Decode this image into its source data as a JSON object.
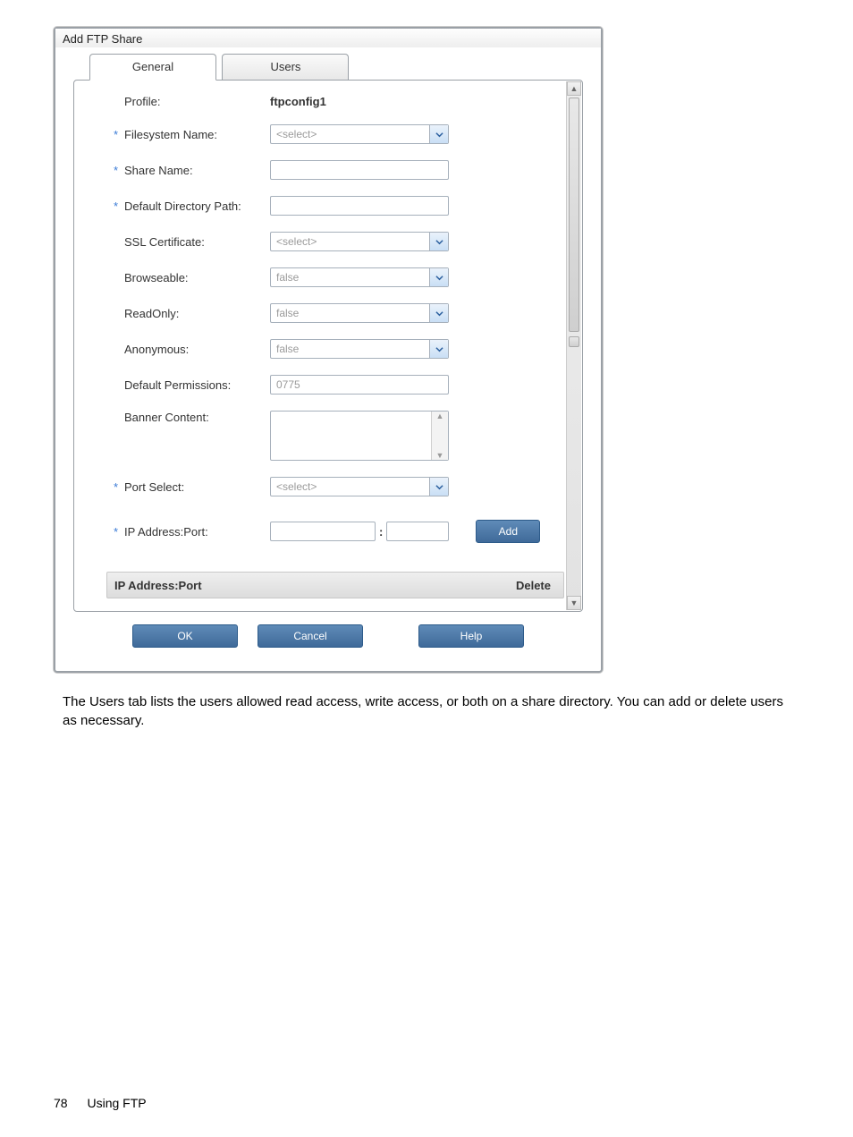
{
  "dialog": {
    "title": "Add FTP Share",
    "tabs": {
      "general": "General",
      "users": "Users"
    },
    "fields": {
      "profile_label": "Profile:",
      "profile_value": "ftpconfig1",
      "filesystem_label": "Filesystem Name:",
      "share_label": "Share Name:",
      "defdir_label": "Default Directory Path:",
      "ssl_label": "SSL Certificate:",
      "browseable_label": "Browseable:",
      "readonly_label": "ReadOnly:",
      "anonymous_label": "Anonymous:",
      "perm_label": "Default Permissions:",
      "perm_value": "0775",
      "banner_label": "Banner Content:",
      "port_label": "Port Select:",
      "ip_label": "IP Address:Port:",
      "select_placeholder": "<select>",
      "false_value": "false",
      "add_btn": "Add",
      "subheader_title": "IP Address:Port",
      "subheader_action": "Delete"
    },
    "footer": {
      "ok": "OK",
      "cancel": "Cancel",
      "help": "Help"
    }
  },
  "caption": "The Users tab lists the users allowed read access, write access, or both on a share directory. You can add or delete users as necessary.",
  "page_footer": {
    "number": "78",
    "section": "Using FTP"
  },
  "req_marker": "*"
}
